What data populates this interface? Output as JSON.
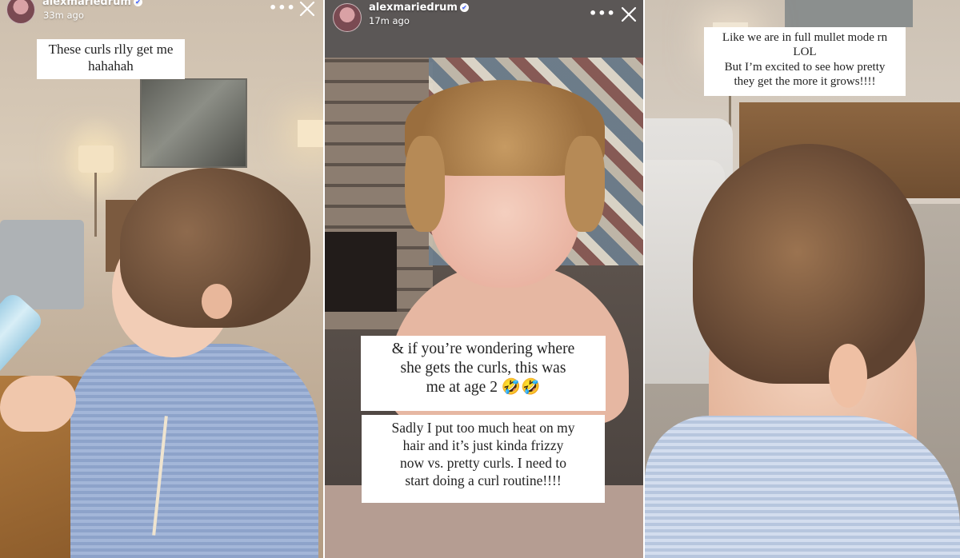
{
  "stories": [
    {
      "username": "alexmariedrum",
      "timestamp": "33m ago",
      "caption": [
        "These curls rlly get me",
        "hahahah"
      ],
      "icons": {
        "avatar": "profile-avatar",
        "verified": "verified-badge-icon",
        "more": "more-options-icon",
        "close": "close-icon"
      }
    },
    {
      "username": "alexmariedrum",
      "timestamp": "17m ago",
      "caption_1": [
        "& if you’re wondering where",
        "she gets the curls, this was",
        "me at age 2 🤣🤣"
      ],
      "caption_2": [
        "Sadly I put too much heat on my",
        "hair and it’s just kinda frizzy",
        "now vs. pretty curls. I need to",
        "start doing a curl routine!!!!"
      ]
    },
    {
      "caption": [
        "Like we are in full mullet mode rn",
        "LOL",
        "But I’m excited to see how pretty",
        "they get the more it grows!!!!"
      ]
    }
  ],
  "colors": {
    "caption_bg": "#ffffff",
    "caption_text": "#222222",
    "photo_bottom_bar": "#b59d92"
  }
}
